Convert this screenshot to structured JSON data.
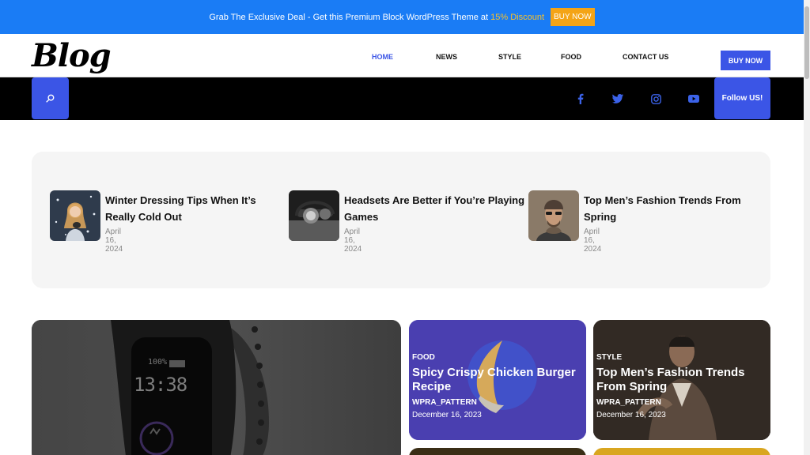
{
  "promo": {
    "text": "Grab The Exclusive Deal - Get this Premium Block WordPress Theme at",
    "discount": "15% Discount",
    "button": "BUY NOW"
  },
  "header": {
    "logo": "Blog",
    "nav": [
      "HOME",
      "NEWS",
      "STYLE",
      "FOOD",
      "CONTACT US"
    ],
    "active_nav": "HOME",
    "buy_button": "BUY NOW"
  },
  "toolbar": {
    "follow_label": "Follow US!",
    "social_icons": [
      "facebook-icon",
      "twitter-icon",
      "instagram-icon",
      "youtube-icon"
    ]
  },
  "featured": [
    {
      "title": "Winter Dressing Tips When It’s Really Cold Out",
      "date": "April 16, 2024"
    },
    {
      "title": "Headsets Are Better if You’re Playing Games",
      "date": "April 16, 2024"
    },
    {
      "title": "Top Men’s Fashion Trends From Spring",
      "date": "April 16, 2024"
    }
  ],
  "cards": [
    {
      "category": "FOOD",
      "title": "Spicy Crispy Chicken Burger Recipe",
      "author": "WPRA_PATTERN",
      "date": "December 16, 2023"
    },
    {
      "category": "STYLE",
      "title": "Top Men’s Fashion Trends From Spring",
      "author": "WPRA_PATTERN",
      "date": "December 16, 2023"
    }
  ],
  "watch_display": {
    "percent": "100%",
    "time": "13:38"
  },
  "colors": {
    "promo_bar": "#1a7cf5",
    "accent": "#3b55e6",
    "buy_orange": "#f4a416",
    "discount_yellow": "#f7c02b"
  }
}
